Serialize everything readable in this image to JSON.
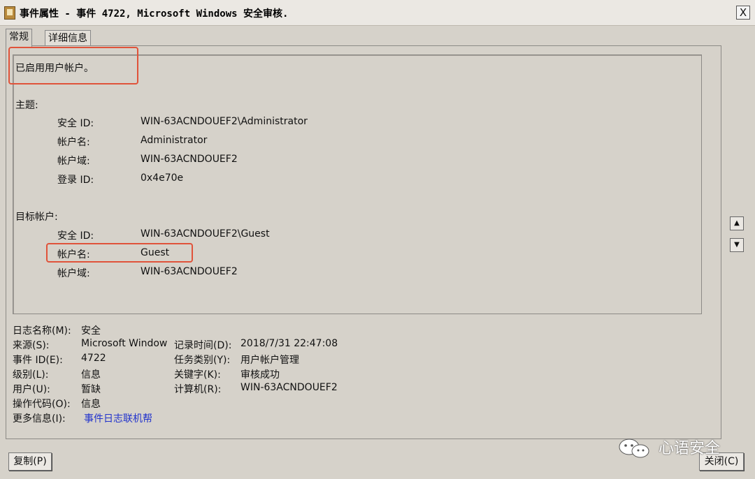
{
  "window": {
    "title": "事件属性 - 事件 4722, Microsoft Windows 安全审核.",
    "close_label": "X"
  },
  "tabs": [
    {
      "label": "常规"
    },
    {
      "label": "详细信息"
    }
  ],
  "description": {
    "headline": "已启用用户帐户。",
    "subject_heading": "主题:",
    "subject": [
      {
        "label": "安全 ID:",
        "value": "WIN-63ACNDOUEF2\\Administrator"
      },
      {
        "label": "帐户名:",
        "value": "Administrator"
      },
      {
        "label": "帐户域:",
        "value": "WIN-63ACNDOUEF2"
      },
      {
        "label": "登录 ID:",
        "value": "0x4e70e"
      }
    ],
    "target_heading": "目标帐户:",
    "target": [
      {
        "label": "安全 ID:",
        "value": "WIN-63ACNDOUEF2\\Guest"
      },
      {
        "label": "帐户名:",
        "value": "Guest"
      },
      {
        "label": "帐户域:",
        "value": "WIN-63ACNDOUEF2"
      }
    ]
  },
  "scroll": {
    "up_icon": "arrow-up-icon",
    "down_icon": "arrow-down-icon",
    "up_glyph": "▲",
    "down_glyph": "▼"
  },
  "meta": {
    "log_name": {
      "label": "日志名称(M):",
      "value": "安全"
    },
    "source": {
      "label": "来源(S):",
      "value": "Microsoft Window"
    },
    "logged": {
      "label": "记录时间(D):",
      "value": "2018/7/31 22:47:08"
    },
    "event_id": {
      "label": "事件 ID(E):",
      "value": "4722"
    },
    "task_category": {
      "label": "任务类别(Y):",
      "value": "用户帐户管理"
    },
    "level": {
      "label": "级别(L):",
      "value": "信息"
    },
    "keywords": {
      "label": "关键字(K):",
      "value": "审核成功"
    },
    "user": {
      "label": "用户(U):",
      "value": "暂缺"
    },
    "computer": {
      "label": "计算机(R):",
      "value": "WIN-63ACNDOUEF2"
    },
    "opcode": {
      "label": "操作代码(O):",
      "value": "信息"
    },
    "more_info": {
      "label": "更多信息(I):",
      "link": "事件日志联机帮"
    }
  },
  "buttons": {
    "copy": "复制(P)",
    "close": "关闭(C)"
  },
  "watermark": {
    "text": "心语安全",
    "icon": "wechat-icon"
  },
  "colors": {
    "annotation_box": "#e0533a",
    "link": "#2233cc"
  }
}
